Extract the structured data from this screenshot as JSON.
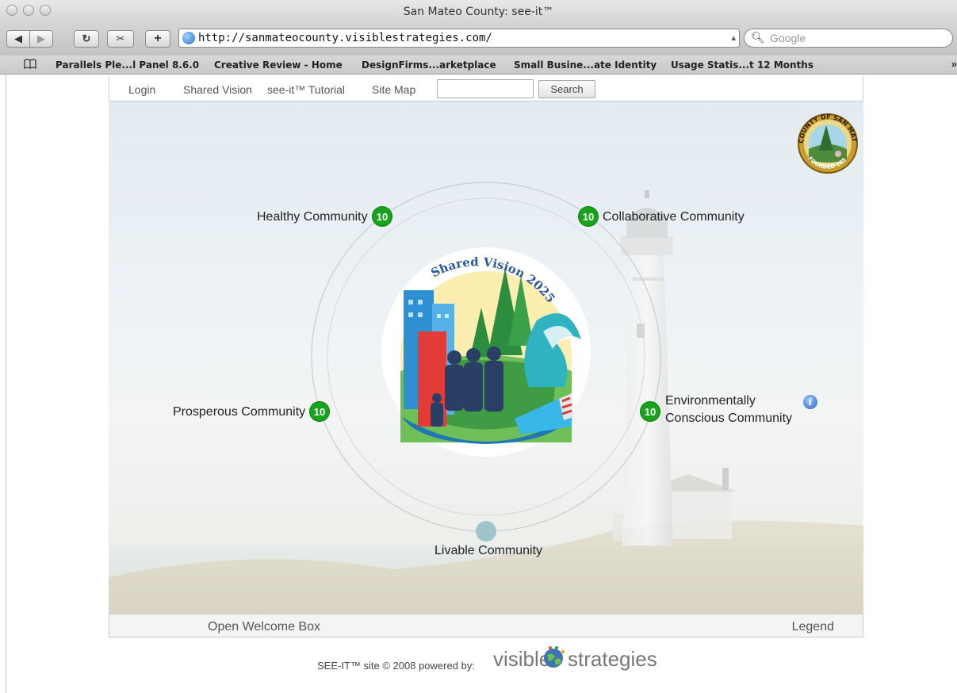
{
  "window": {
    "title": "San Mateo County: see-it™"
  },
  "toolbar": {
    "url": "http://sanmateocounty.visiblestrategies.com/",
    "search_placeholder": "Google",
    "back_icon": "back-arrow-icon",
    "forward_icon": "forward-arrow-icon",
    "reload_icon": "reload-icon",
    "snippet_icon": "webclip-icon",
    "add_label": "+"
  },
  "bookmarks": [
    "Parallels Ple...l Panel 8.6.0",
    "Creative Review - Home",
    "DesignFirms...arketplace",
    "Small Busine...ate Identity",
    "Usage Statis...t 12 Months"
  ],
  "bookmarks_more": "»",
  "site_nav": {
    "items": [
      "Login",
      "Shared Vision",
      "see-it™ Tutorial",
      "Site Map"
    ],
    "search_value": "",
    "search_button": "Search"
  },
  "seal": {
    "top_text": "COUNTY OF SAN MATEO",
    "bottom_text": "FOUNDED 1856"
  },
  "emblem": {
    "text": "Shared Vision 2025"
  },
  "communities": [
    {
      "label": "Healthy Community",
      "count": "10"
    },
    {
      "label": "Collaborative Community",
      "count": "10"
    },
    {
      "label": "Prosperous Community",
      "count": "10"
    },
    {
      "label": "Environmentally",
      "label2": "Conscious Community",
      "count": "10"
    },
    {
      "label": "Livable Community",
      "count": ""
    }
  ],
  "footer": {
    "left": "Open Welcome Box",
    "right": "Legend"
  },
  "powered": {
    "text": "SEE-IT™ site © 2008 powered by:",
    "brand1": "visible",
    "brand2": "strategies"
  },
  "colors": {
    "badge_green": "#18a31c",
    "info_blue": "#2864c7",
    "livable_dot": "#9fc4c9"
  }
}
